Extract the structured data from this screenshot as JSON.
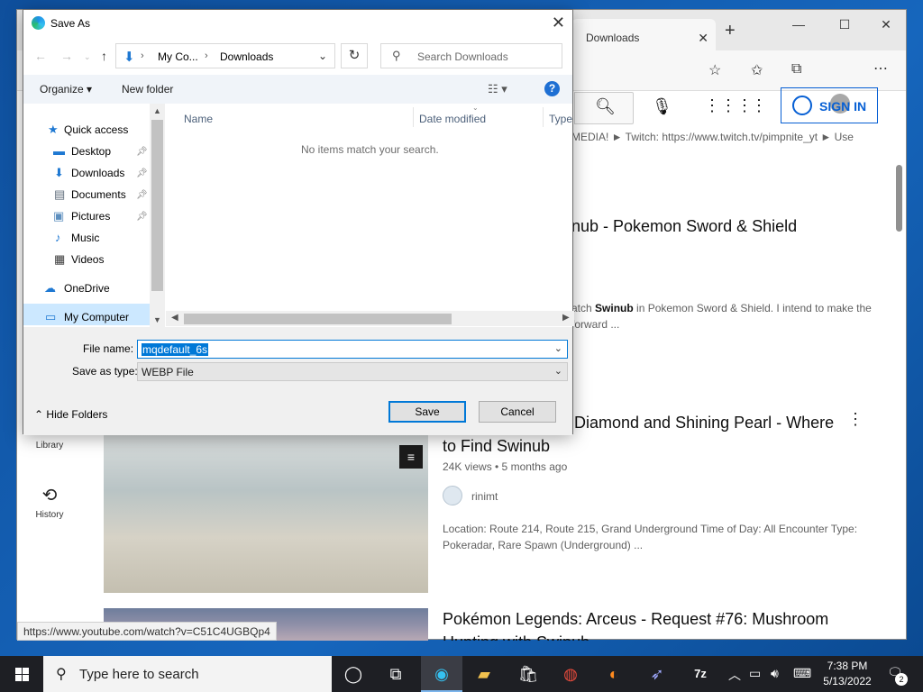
{
  "browser": {
    "tab_label": "Downloads",
    "tab_close": "✕",
    "new_tab": "+",
    "minimize": "—",
    "maximize": "☐",
    "close": "✕",
    "sign_in": "SIGN IN",
    "status_url": "https://www.youtube.com/watch?v=C51C4UGBQp4"
  },
  "youtube": {
    "left_nav": [
      {
        "label": "Library",
        "icon": "library-icon"
      },
      {
        "label": "History",
        "icon": "history-icon"
      }
    ],
    "partial_line1": "MEDIA! ► Twitch: https://www.twitch.tv/pimpnite_yt ► Use",
    "result1_title_partial": "nub - Pokemon Sword & Shield",
    "result1_desc_prefix": "atch ",
    "result1_desc_bold": "Swinub",
    "result1_desc_rest": " in Pokemon Sword & Shield. I intend to make the",
    "result1_desc_line2": "forward ...",
    "result2_title_line1": "Diamond and Shining Pearl - Where",
    "result2_title_line2": "to Find Swinub",
    "result2_meta": "24K views • 5 months ago",
    "result2_channel": "rinimt",
    "result2_desc_line1": "Location: Route 214, Route 215, Grand Underground Time of Day: All Encounter Type:",
    "result2_desc_line2": "Pokeradar, Rare Spawn (Underground) ...",
    "result3_title_line1": "Pokémon Legends: Arceus - Request #76: Mushroom",
    "result3_title_line2": "Hunting with Swinub"
  },
  "dialog": {
    "title": "Save As",
    "close": "✕",
    "breadcrumb": [
      "My Co...",
      "Downloads"
    ],
    "search_placeholder": "Search Downloads",
    "toolbar": {
      "organize": "Organize ▾",
      "new_folder": "New folder"
    },
    "tree": [
      {
        "label": "Quick access",
        "icon": "star-icon"
      },
      {
        "label": "Desktop",
        "icon": "desktop-icon",
        "pinned": true
      },
      {
        "label": "Downloads",
        "icon": "download-icon",
        "pinned": true
      },
      {
        "label": "Documents",
        "icon": "document-icon",
        "pinned": true
      },
      {
        "label": "Pictures",
        "icon": "pictures-icon",
        "pinned": true
      },
      {
        "label": "Music",
        "icon": "music-icon"
      },
      {
        "label": "Videos",
        "icon": "video-icon"
      },
      {
        "label": "OneDrive",
        "icon": "cloud-icon"
      },
      {
        "label": "My Computer",
        "icon": "computer-icon"
      }
    ],
    "columns": [
      "Name",
      "Date modified",
      "Type"
    ],
    "empty_message": "No items match your search.",
    "file_name_label": "File name:",
    "file_name_value": "mqdefault_6s",
    "save_type_label": "Save as type:",
    "save_type_value": "WEBP File",
    "hide_folders": "Hide Folders",
    "save_button": "Save",
    "cancel_button": "Cancel"
  },
  "taskbar": {
    "search_placeholder": "Type here to search",
    "time": "7:38 PM",
    "date": "5/13/2022",
    "notifications": "2"
  }
}
